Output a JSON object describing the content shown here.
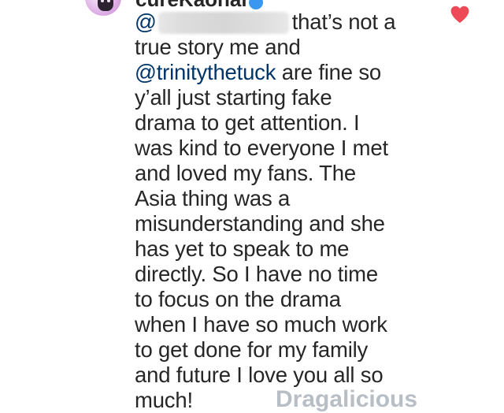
{
  "comment": {
    "username": "cureKaonara",
    "mention_redacted": "@",
    "text_after_redacted": "that’s not a",
    "lines": [
      "true story me and",
      "y’all just starting fake",
      "drama to get attention. I",
      "was kind to everyone I met",
      "and loved my fans. The",
      "Asia thing was a",
      "misunderstanding and she",
      "has yet to speak to me",
      "directly. So I have no time",
      "to focus on the drama",
      "when I have so much work",
      "to get done for my family",
      "and future I love you all so",
      "much!"
    ],
    "mention_trinity": "@trinitythetuck",
    "text_after_trinity": "are fine so"
  },
  "icons": {
    "like": "heart-icon",
    "verified": "verified-badge-icon"
  },
  "colors": {
    "text": "#262626",
    "mention": "#003569",
    "like": "#ed4956",
    "verified": "#3897f0"
  },
  "watermark": {
    "text": "Dragalicious"
  }
}
